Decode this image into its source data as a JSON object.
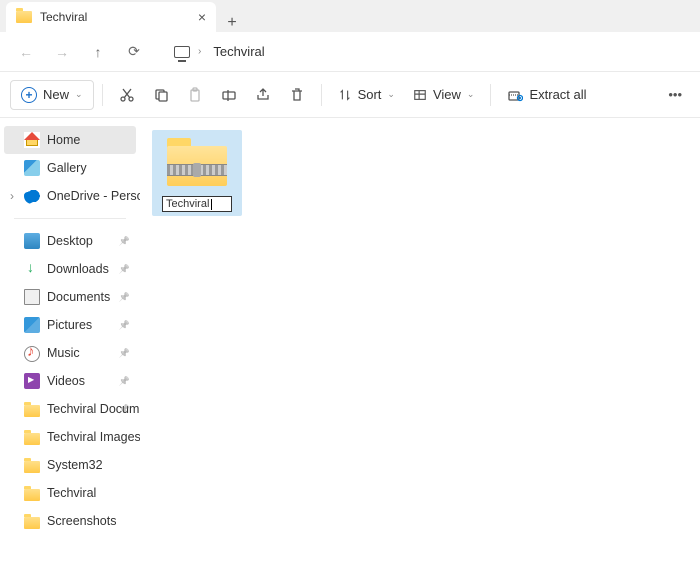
{
  "tab": {
    "title": "Techviral"
  },
  "breadcrumb": "Techviral",
  "toolbar": {
    "new": "New",
    "sort": "Sort",
    "view": "View",
    "extract": "Extract all"
  },
  "sidebar": {
    "top": [
      {
        "label": "Home",
        "icon": "home",
        "selected": true
      },
      {
        "label": "Gallery",
        "icon": "gallery"
      },
      {
        "label": "OneDrive - Persona",
        "icon": "onedrive",
        "expandable": true
      }
    ],
    "quick": [
      {
        "label": "Desktop",
        "icon": "desktop",
        "pinned": true
      },
      {
        "label": "Downloads",
        "icon": "downloads",
        "pinned": true
      },
      {
        "label": "Documents",
        "icon": "documents",
        "pinned": true
      },
      {
        "label": "Pictures",
        "icon": "pictures",
        "pinned": true
      },
      {
        "label": "Music",
        "icon": "music",
        "pinned": true
      },
      {
        "label": "Videos",
        "icon": "videos",
        "pinned": true
      },
      {
        "label": "Techviral Docum",
        "icon": "folder",
        "pinned": true
      },
      {
        "label": "Techviral Images",
        "icon": "folder"
      },
      {
        "label": "System32",
        "icon": "folder"
      },
      {
        "label": "Techviral",
        "icon": "folder"
      },
      {
        "label": "Screenshots",
        "icon": "folder"
      }
    ]
  },
  "file": {
    "name": "Techviral"
  }
}
